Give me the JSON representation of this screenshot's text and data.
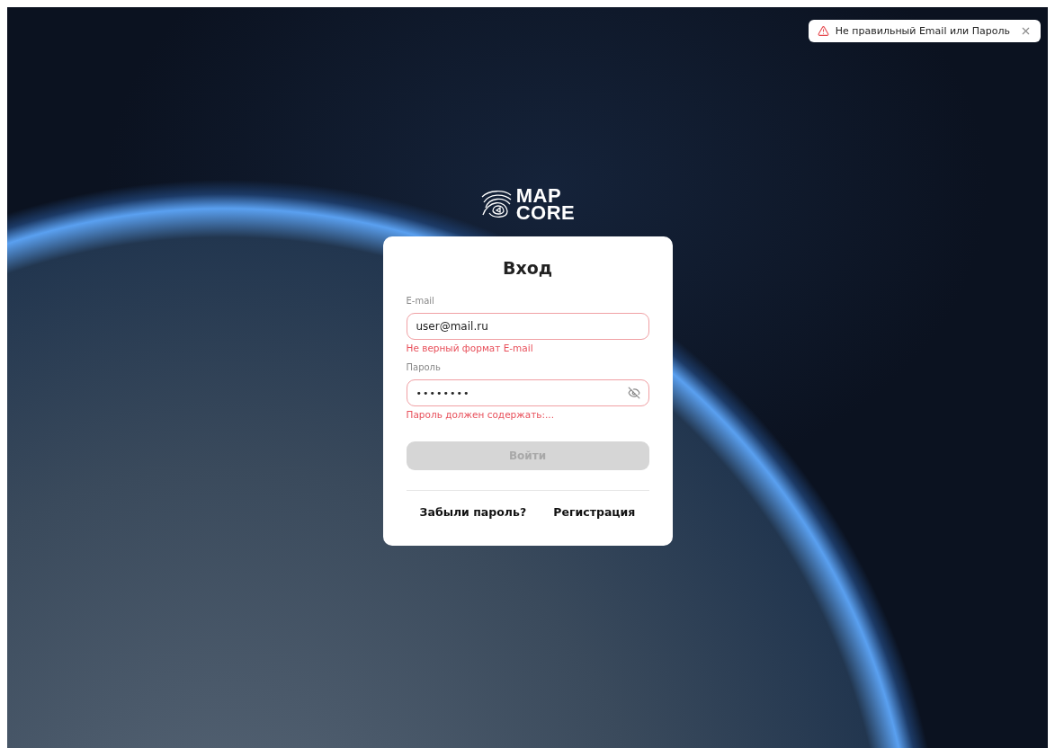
{
  "toast": {
    "kind": "error",
    "message": "Не правильный Email или Пароль"
  },
  "logo": {
    "line_1": "MAP",
    "line_2": "CORE"
  },
  "form": {
    "title": "Вход",
    "fields": [
      {
        "kind": "text",
        "label": "E-mail",
        "value": "user@mail.ru",
        "error": true,
        "error_text": "Не верный формат E-mail"
      },
      {
        "kind": "password",
        "label": "Пароль",
        "value": "••••••••",
        "error": true,
        "error_text": "Пароль должен содержать:..."
      }
    ],
    "submit": {
      "label": "Войти",
      "disabled": true
    },
    "links": [
      "Забыли пароль?",
      "Регистрация"
    ]
  }
}
